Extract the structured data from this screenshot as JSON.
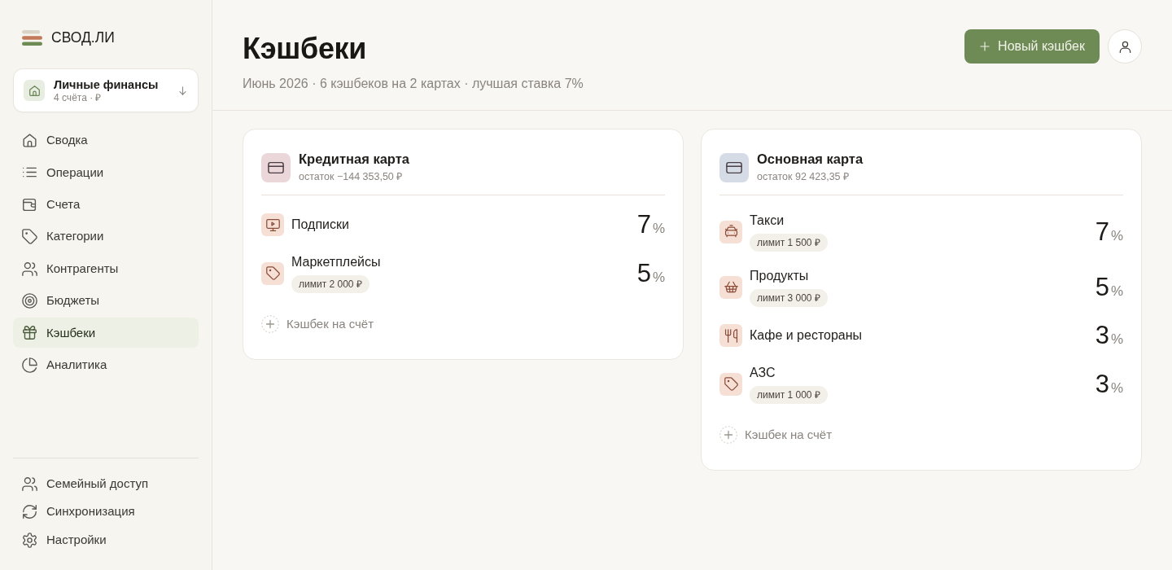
{
  "sidebar": {
    "logo": {
      "text": "СВОД.ЛИ"
    },
    "workspace": {
      "name": "Личные финансы",
      "subtitle": "4 счёта · ₽"
    },
    "nav": [
      {
        "label": "Сводка",
        "kind": "summary",
        "selected": false
      },
      {
        "label": "Операции",
        "kind": "operations",
        "selected": false
      },
      {
        "label": "Счета",
        "kind": "accounts",
        "selected": false
      },
      {
        "label": "Категории",
        "kind": "categories",
        "selected": false
      },
      {
        "label": "Контрагенты",
        "kind": "contacts",
        "selected": false
      },
      {
        "label": "Бюджеты",
        "kind": "budgets",
        "selected": false
      },
      {
        "label": "Кэшбеки",
        "kind": "cashback",
        "selected": true
      },
      {
        "label": "Аналитика",
        "kind": "analytics",
        "selected": false
      }
    ],
    "footer_nav": [
      {
        "label": "Семейный доступ",
        "kind": "family",
        "selected": false
      },
      {
        "label": "Синхронизация",
        "kind": "sync",
        "selected": false
      },
      {
        "label": "Настройки",
        "kind": "settings",
        "selected": false
      }
    ]
  },
  "header": {
    "title": "Кэшбеки",
    "subtitle": "Июнь 2026 · 6 кэшбеков на 2 картах · лучшая ставка 7%",
    "new_button": {
      "label": "Новый кэшбек"
    }
  },
  "cards": [
    {
      "title": "Кредитная карта",
      "balance": "остаток −144 353,50 ₽",
      "color": "#ebd7d9",
      "cashbacks": [
        {
          "name": "Подписки",
          "kind": "subscriptions",
          "rate": "7",
          "unit": "%"
        },
        {
          "name": "Маркетплейсы",
          "kind": "marketplaces",
          "limit": "лимит 2 000 ₽",
          "rate": "5",
          "unit": "%"
        }
      ],
      "add_label": "Кэшбек на счёт"
    },
    {
      "title": "Основная карта",
      "balance": "остаток 92 423,35 ₽",
      "color": "#d5dce6",
      "cashbacks": [
        {
          "name": "Такси",
          "kind": "taxi",
          "limit": "лимит 1 500 ₽",
          "rate": "7",
          "unit": "%"
        },
        {
          "name": "Продукты",
          "kind": "groceries",
          "limit": "лимит 3 000 ₽",
          "rate": "5",
          "unit": "%"
        },
        {
          "name": "Кафе и рестораны",
          "kind": "cafe",
          "rate": "3",
          "unit": "%"
        },
        {
          "name": "АЗС",
          "kind": "fuel",
          "limit": "лимит 1 000 ₽",
          "rate": "3",
          "unit": "%"
        }
      ],
      "add_label": "Кэшбек на счёт"
    }
  ]
}
